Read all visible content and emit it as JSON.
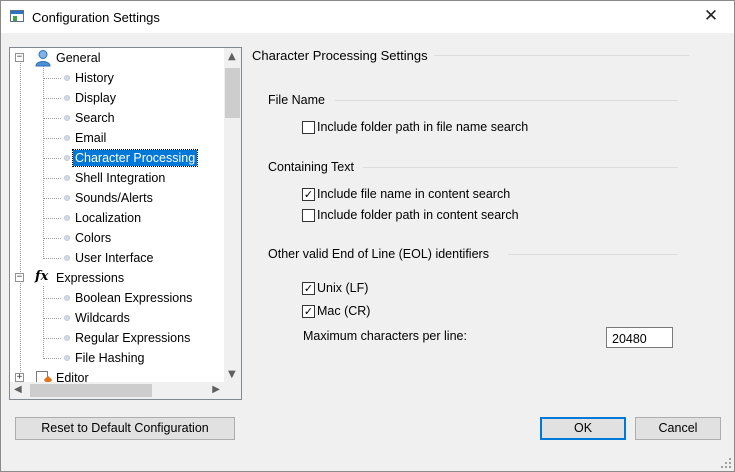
{
  "window": {
    "title": "Configuration Settings",
    "close_glyph": "✕"
  },
  "tree": {
    "nodes": [
      {
        "label": "General",
        "icon": "user-icon",
        "level": 0,
        "expander": "−"
      },
      {
        "label": "History",
        "level": 1
      },
      {
        "label": "Display",
        "level": 1
      },
      {
        "label": "Search",
        "level": 1
      },
      {
        "label": "Email",
        "level": 1
      },
      {
        "label": "Character Processing",
        "level": 1,
        "selected": true
      },
      {
        "label": "Shell Integration",
        "level": 1
      },
      {
        "label": "Sounds/Alerts",
        "level": 1
      },
      {
        "label": "Localization",
        "level": 1
      },
      {
        "label": "Colors",
        "level": 1
      },
      {
        "label": "User Interface",
        "level": 1
      },
      {
        "label": "Expressions",
        "icon": "fx-icon",
        "icon_text": "fx",
        "level": 0,
        "expander": "−"
      },
      {
        "label": "Boolean Expressions",
        "level": 1
      },
      {
        "label": "Wildcards",
        "level": 1
      },
      {
        "label": "Regular Expressions",
        "level": 1
      },
      {
        "label": "File Hashing",
        "level": 1
      },
      {
        "label": "Editor",
        "icon": "document-icon",
        "level": 0,
        "expander": "+"
      }
    ],
    "scroll_up": "▲",
    "scroll_down": "▼",
    "scroll_left": "◀",
    "scroll_right": "▶"
  },
  "panel": {
    "title": "Character Processing Settings",
    "file_name": {
      "header": "File Name",
      "include_folder_path": {
        "label": "Include folder path in file name search",
        "checked": false
      }
    },
    "containing_text": {
      "header": "Containing Text",
      "include_file_name": {
        "label": "Include file name in content search",
        "checked": true
      },
      "include_folder_path": {
        "label": "Include folder path in content search",
        "checked": false
      }
    },
    "eol": {
      "header": "Other valid End of Line (EOL) identifiers",
      "unix": {
        "label": "Unix (LF)",
        "checked": true
      },
      "mac": {
        "label": "Mac (CR)",
        "checked": true
      },
      "max_chars_label": "Maximum characters per line:",
      "max_chars_value": "20480"
    },
    "check_glyph": "✓"
  },
  "buttons": {
    "reset": "Reset to Default Configuration",
    "ok": "OK",
    "cancel": "Cancel"
  }
}
